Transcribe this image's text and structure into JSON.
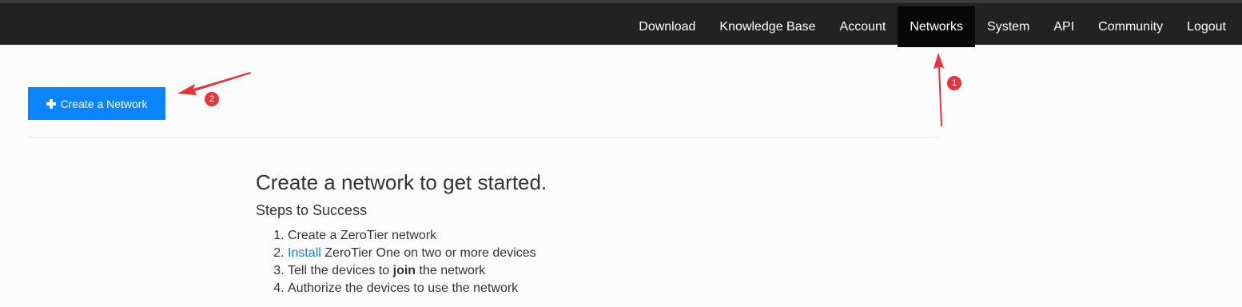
{
  "nav": {
    "items": [
      {
        "label": "Download",
        "active": false
      },
      {
        "label": "Knowledge Base",
        "active": false
      },
      {
        "label": "Account",
        "active": false
      },
      {
        "label": "Networks",
        "active": true
      },
      {
        "label": "System",
        "active": false
      },
      {
        "label": "API",
        "active": false
      },
      {
        "label": "Community",
        "active": false
      },
      {
        "label": "Logout",
        "active": false
      }
    ]
  },
  "toolbar": {
    "create_label": "Create a Network",
    "create_icon": "plus-icon"
  },
  "main": {
    "heading": "Create a network to get started.",
    "subheading": "Steps to Success",
    "steps": [
      {
        "parts": [
          "Create a ZeroTier network"
        ]
      },
      {
        "link": "Install",
        "rest": " ZeroTier One on two or more devices"
      },
      {
        "pre": "Tell the devices to ",
        "bold": "join",
        "post": " the network"
      },
      {
        "parts": [
          "Authorize the devices to use the network"
        ]
      }
    ]
  },
  "annotations": {
    "badge_1": "1",
    "badge_2": "2",
    "color": "#e8333a"
  },
  "colors": {
    "topbar": "#222222",
    "active_nav": "#080808",
    "button": "#0a84ff",
    "link": "#1a7bd6"
  }
}
